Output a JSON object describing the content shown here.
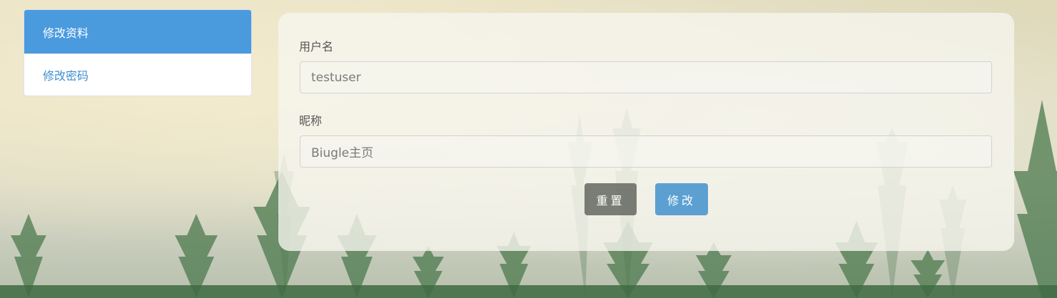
{
  "sidebar": {
    "items": [
      {
        "label": "修改资料",
        "active": true
      },
      {
        "label": "修改密码",
        "active": false
      }
    ]
  },
  "form": {
    "username_label": "用户名",
    "username_value": "testuser",
    "nickname_label": "昵称",
    "nickname_value": "Biugle主页",
    "reset_label": "重置",
    "submit_label": "修改"
  },
  "colors": {
    "accent": "#4a9ade",
    "link": "#3f8ecf",
    "reset_button": "#585c55",
    "submit_button": "#4292ce"
  }
}
